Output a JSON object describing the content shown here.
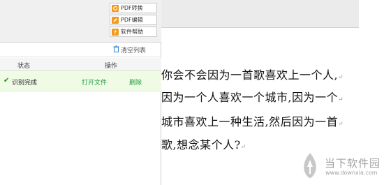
{
  "toolbar": {
    "buttons": [
      {
        "label": "PDF转换",
        "icon": "refresh-icon"
      },
      {
        "label": "PDF编辑",
        "icon": "pencil-icon"
      },
      {
        "label": "软件帮助",
        "icon": "question-icon"
      }
    ],
    "accent_color": "#f39a1c"
  },
  "list": {
    "clear_label": "清空列表",
    "columns": [
      "状态",
      "操作"
    ],
    "rows": [
      {
        "status": "识别完成",
        "open_label": "打开文件",
        "delete_label": "删除"
      }
    ]
  },
  "document": {
    "lines": [
      "你会不会因为一首歌喜欢上一个人,",
      "因为一个人喜欢一个城市,因为一个",
      "城市喜欢上一种生活,然后因为一首",
      "歌,想念某个人?"
    ],
    "paragraph_mark": "↵"
  },
  "watermark": {
    "cn": "当下软件园",
    "url": "www.downxia.com"
  }
}
